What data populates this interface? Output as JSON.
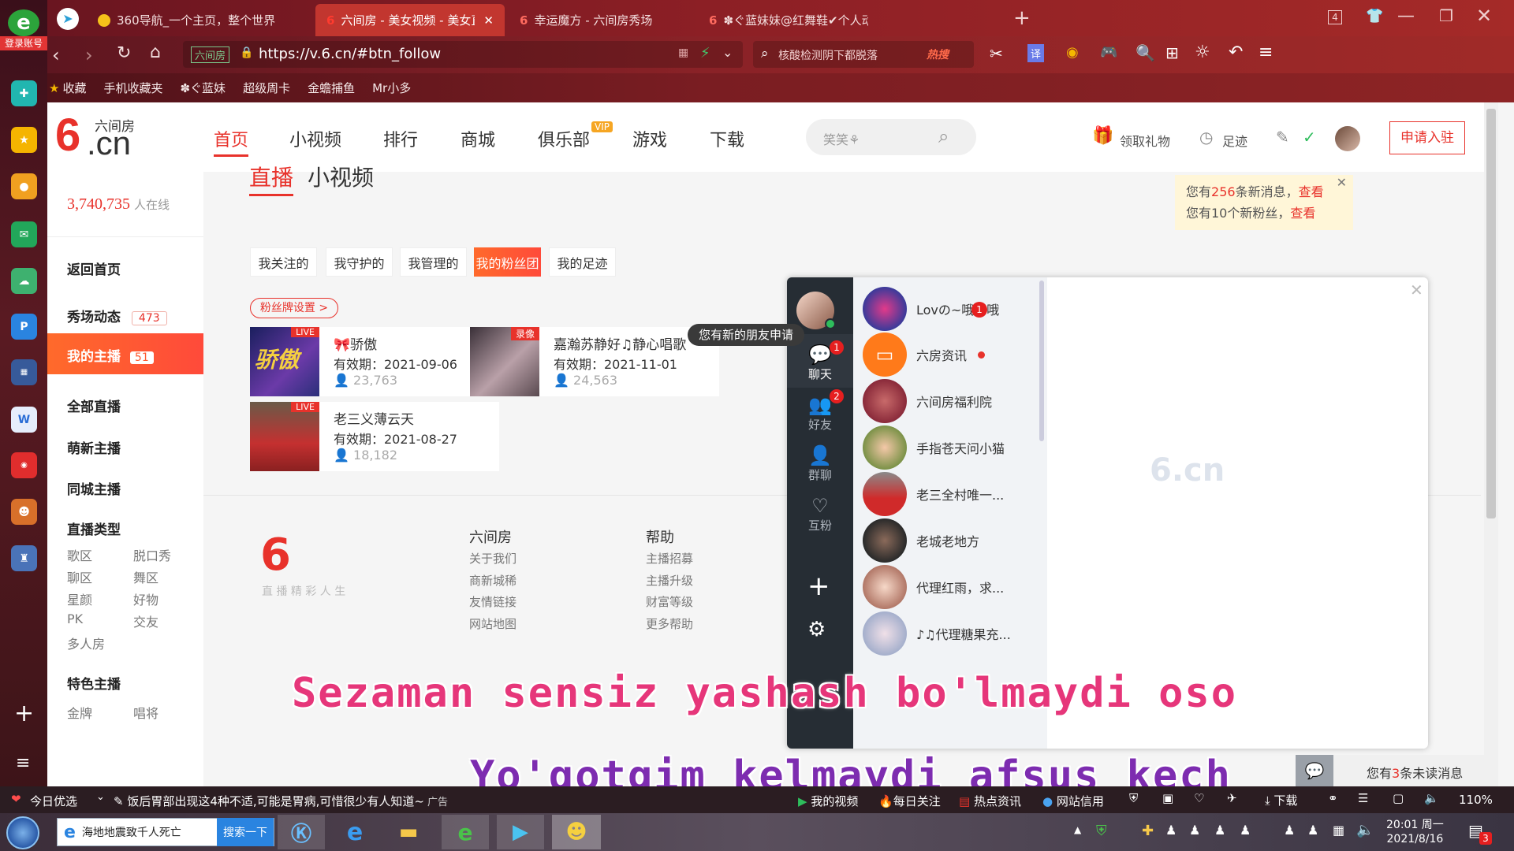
{
  "sidebar_left": {
    "login_label": "登录账号",
    "add_icon": "plus-icon",
    "menu_icon": "list-icon"
  },
  "tabs": [
    {
      "label": "360导航_一个主页，整个世界"
    },
    {
      "label": "六间房 - 美女视频 - 美女直播"
    },
    {
      "label": "幸运魔方 - 六间房秀场"
    },
    {
      "label": "✽ぐ蓝妹妹@红舞鞋✔个人动态"
    }
  ],
  "tab_count": "4",
  "address": {
    "site_tag": "六间房",
    "url": "https://v.6.cn/#btn_follow",
    "search_text": "核酸检测阴下都脱落",
    "hot_label": "热搜"
  },
  "bookmarks": [
    "收藏",
    "手机收藏夹",
    "✽ぐ蓝妹",
    "超级周卡",
    "金蟾捕鱼",
    "Mr小多"
  ],
  "site": {
    "logo_sub": "六间房",
    "logo_main": ".cn",
    "nav": [
      "首页",
      "小视频",
      "排行",
      "商城",
      "俱乐部",
      "游戏",
      "下载"
    ],
    "vip_badge": "VIP",
    "search_placeholder": "笑笑⚘",
    "gift_label": "领取礼物",
    "footprint_label": "足迹",
    "apply_button": "申请入驻"
  },
  "notice": {
    "line1_pre": "您有",
    "line1_num": "256",
    "line1_mid": "条新消息，",
    "line1_link": "查看",
    "line2_pre": "您有10个新粉丝，",
    "line2_link": "查看"
  },
  "left_menu": {
    "online_count": "3,740,735",
    "online_label": "人在线",
    "items": [
      {
        "label": "返回首页"
      },
      {
        "label": "秀场动态",
        "count": "473"
      },
      {
        "label": "我的主播",
        "count": "51"
      },
      {
        "label": "全部直播"
      },
      {
        "label": "萌新主播"
      },
      {
        "label": "同城主播"
      }
    ],
    "category_title": "直播类型",
    "categories": [
      "歌区",
      "脱口秀",
      "聊区",
      "舞区",
      "星颜",
      "好物",
      "PK",
      "交友",
      "多人房"
    ],
    "special_title": "特色主播",
    "special_items": [
      "金牌",
      "唱将"
    ]
  },
  "main": {
    "tab_live": "直播",
    "tab_video": "小视频",
    "filters": [
      "我关注的",
      "我守护的",
      "我管理的",
      "我的粉丝团",
      "我的足迹"
    ],
    "fan_badge_btn": "粉丝牌设置 >",
    "cards": [
      {
        "tag": "LIVE",
        "title": "🎀骄傲",
        "expire": "有效期：2021-09-06",
        "fans": "23,763",
        "thumb_text": "骄傲"
      },
      {
        "tag": "录像",
        "title": "嘉瀚苏静好♫静心唱歌",
        "expire": "有效期：2021-11-01",
        "fans": "24,563",
        "thumb_text": ""
      },
      {
        "tag": "LIVE",
        "title": "老三义薄云天",
        "expire": "有效期：2021-08-27",
        "fans": "18,182",
        "thumb_text": ""
      }
    ]
  },
  "footer": {
    "logo_slogan": "直 播 精 彩 人 生",
    "col1_title": "六间房",
    "col1_items": [
      "关于我们",
      "商新城稀",
      "友情链接",
      "网站地图"
    ],
    "col2_title": "帮助",
    "col2_items": [
      "主播招募",
      "主播升级",
      "财富等级",
      "更多帮助"
    ]
  },
  "chat": {
    "tooltip": "您有新的朋友申请",
    "rail": [
      {
        "label": "聊天",
        "badge": "1"
      },
      {
        "label": "好友",
        "badge": "2"
      },
      {
        "label": "群聊"
      },
      {
        "label": "互粉"
      }
    ],
    "contacts": [
      {
        "name": "Lovの~哦嗯哦",
        "badge": "1"
      },
      {
        "name": "六房资讯"
      },
      {
        "name": "六间房福利院"
      },
      {
        "name": "手指苍天问小猫"
      },
      {
        "name": "老三全村唯一..."
      },
      {
        "name": "老城老地方"
      },
      {
        "name": "代理红雨，求..."
      },
      {
        "name": "♪♫代理糖果充..."
      }
    ],
    "watermark": "6.cn"
  },
  "unread": {
    "text_pre": "您有",
    "num": "3",
    "text_post": "条未读消息"
  },
  "subtitles": {
    "line1": "Sezaman sensiz yashash bo'lmaydi oso",
    "line2": "Yo'qotgim kelmaydi afsus kech"
  },
  "statusbar": {
    "left_label": "今日优选",
    "news": "饭后胃部出现这4种不适,可能是胃病,可惜很少有人知道~",
    "news_tag": "广告",
    "items": [
      "我的视频",
      "每日关注",
      "热点资讯",
      "网站信用"
    ],
    "download": "下载",
    "zoom": "110%"
  },
  "taskbar": {
    "search_text": "海地地震致千人死亡",
    "search_btn": "搜索一下",
    "time": "20:01 周一",
    "date": "2021/8/16",
    "notif_count": "3"
  },
  "colors": {
    "brand_red": "#e8322b",
    "orange": "#ff6a2b",
    "chat_rail": "#262d34"
  }
}
